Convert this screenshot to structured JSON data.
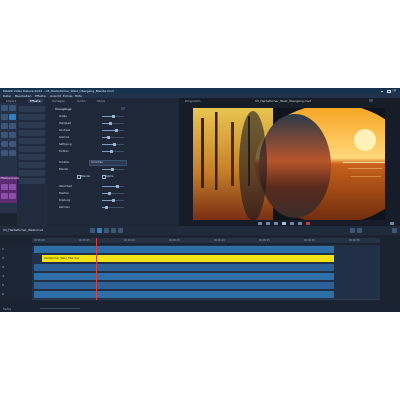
{
  "window": {
    "title": "MAGIX Video Deluxe 2022 – ",
    "title_file": "03_Herbstlicher_Wald_Übergang_Blende.mvd"
  },
  "menu": [
    "Datei",
    "Bearbeiten",
    "Effekte",
    "Ansicht",
    "Extras",
    "Hilfe"
  ],
  "left_tabs": [
    "Import",
    "Effekte",
    "Vorlagen",
    "Audio",
    "Store"
  ],
  "effects_panel": {
    "header": "Übergänge",
    "params": [
      "Größe",
      "Helligkeit",
      "Kontrast",
      "Gamma",
      "Sättigung",
      "Farbton",
      "Schärfe",
      "Blende",
      "Weichheit",
      "Position",
      "Drehung",
      "Rahmen"
    ],
    "select_value": "Vorschau",
    "checkbox_1": "Blende",
    "checkbox_2": "Alpha"
  },
  "param_sidebar_label": "Effektparameter",
  "preview": {
    "label": "Programm",
    "file_label": "03_Herbstlicher_Wald_Übergang.mvd"
  },
  "timeline": {
    "project_name": "03_Herbstlicher_Wald.mvd",
    "ruler_labels": [
      "00:00:00",
      "00:00:05",
      "00:00:10",
      "00:00:15",
      "00:00:20",
      "00:00:25",
      "00:00:30",
      "00:00:35"
    ],
    "tracks": [
      "1",
      "2",
      "3",
      "4",
      "5",
      "6"
    ],
    "yellow_clip_label": "Herbstlicher_Wald_Titel.mxv"
  },
  "status": {
    "text": "Fertig"
  },
  "colors": {
    "accent": "#2e7fc0",
    "yellow_clip": "#f2e21a",
    "param_sidebar": "#5b2a73"
  },
  "icons": [
    "minimize-icon",
    "maximize-icon",
    "close-icon",
    "play-icon",
    "stop-icon",
    "record-icon",
    "scissors-icon",
    "magnet-icon"
  ]
}
